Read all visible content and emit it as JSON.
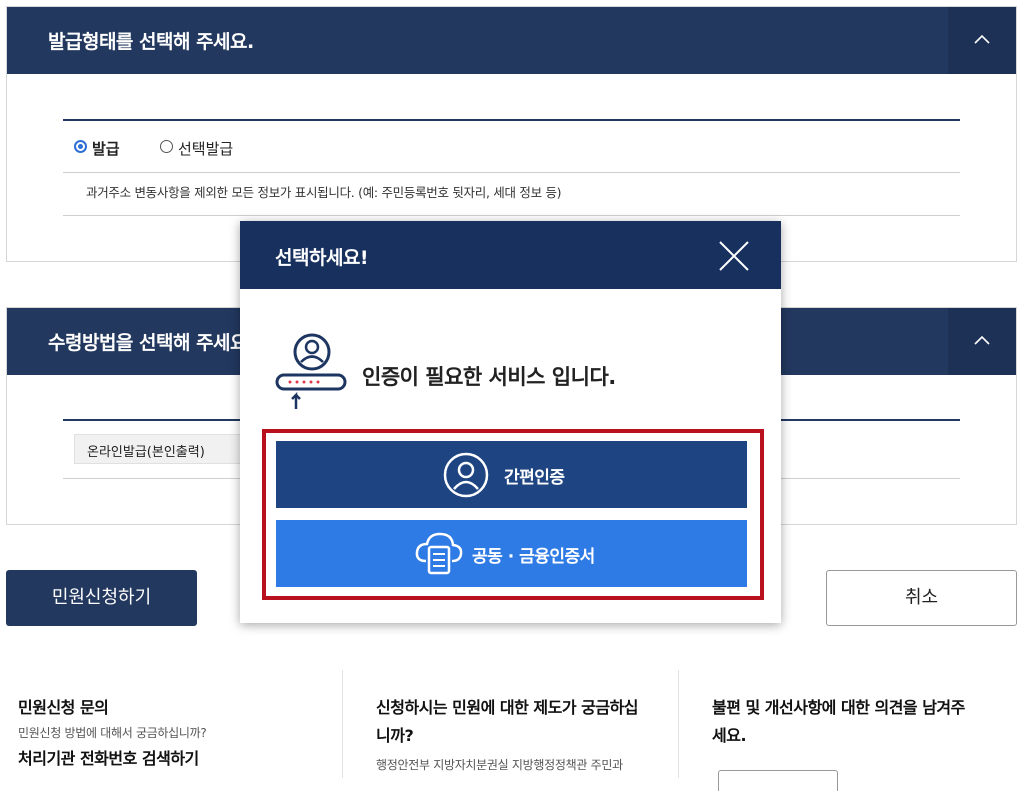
{
  "issue_panel": {
    "title": "발급형태를 선택해 주세요.",
    "options": [
      {
        "label": "발급",
        "selected": true
      },
      {
        "label": "선택발급",
        "selected": false
      }
    ],
    "note": "과거주소 변동사항을 제외한 모든 정보가 표시됩니다. (예: 주민등록번호 뒷자리, 세대 정보 등)"
  },
  "receive_panel": {
    "title": "수령방법을 선택해 주세요.",
    "selected_method": "온라인발급(본인출력)"
  },
  "actions": {
    "apply_label": "민원신청하기",
    "cancel_label": "취소"
  },
  "footer": {
    "col1": {
      "title": "민원신청 문의",
      "sub": "민원신청 방법에 대해서 궁금하십니까?",
      "link": "처리기관 전화번호 검색하기"
    },
    "col2": {
      "title_line1": "신청하시는 민원에 대한 제도가 궁금하십",
      "title_line2": "니까?",
      "sub": "행정안전부 지방자치분권실 지방행정정책관 주민과"
    },
    "col3": {
      "title_line1": "불편 및 개선사항에 대한 의견을 남겨주",
      "title_line2": "세요."
    }
  },
  "modal": {
    "title": "선택하세요!",
    "message": "인증이 필요한 서비스 입니다.",
    "simple_auth_label": "간편인증",
    "cert_auth_label": "공동 · 금융인증서"
  },
  "colors": {
    "navy": "#22385f",
    "modal_navy": "#17305e",
    "simple_btn": "#1e4582",
    "cert_btn": "#2f7be6",
    "highlight": "#b8101d",
    "radio_on": "#2f6fd6"
  }
}
